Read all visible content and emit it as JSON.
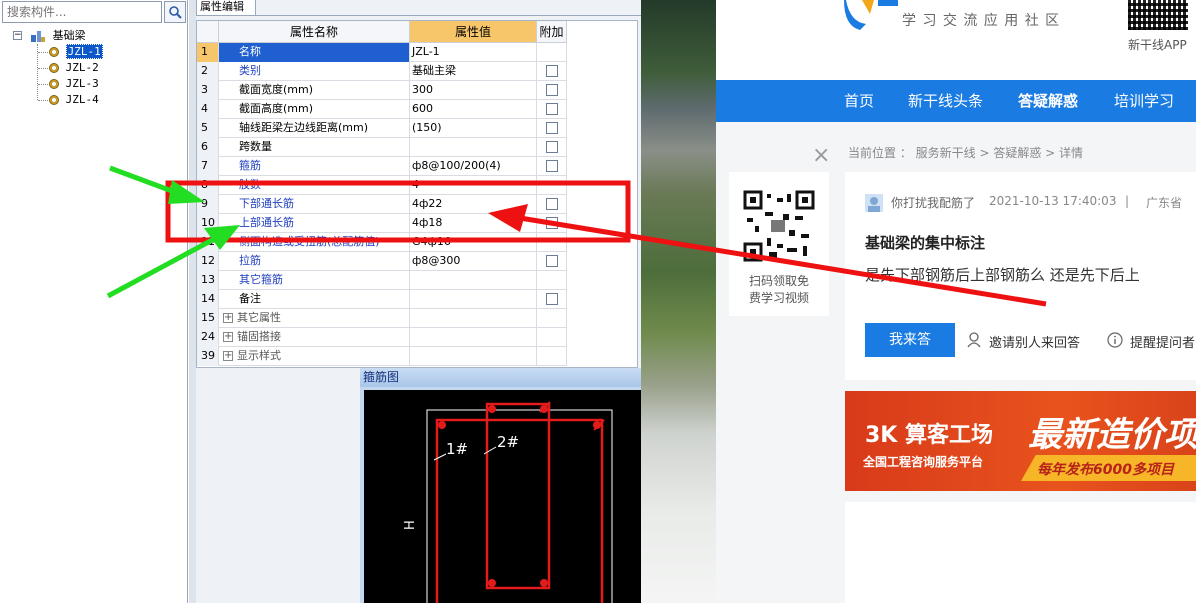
{
  "tree": {
    "search_placeholder": "搜索构件...",
    "root_label": "基础梁",
    "items": [
      "JZL-1",
      "JZL-2",
      "JZL-3",
      "JZL-4"
    ],
    "selected": "JZL-1"
  },
  "props": {
    "tab_label": "属性编辑",
    "headers": {
      "name": "属性名称",
      "value": "属性值",
      "add": "附加"
    },
    "rows": [
      {
        "num": "1",
        "name": "名称",
        "value": "JZL-1",
        "blue": true,
        "checkbox": false
      },
      {
        "num": "2",
        "name": "类别",
        "value": "基础主梁",
        "blue": true,
        "checkbox": true
      },
      {
        "num": "3",
        "name": "截面宽度(mm)",
        "value": "300",
        "blue": false,
        "checkbox": true
      },
      {
        "num": "4",
        "name": "截面高度(mm)",
        "value": "600",
        "blue": false,
        "checkbox": true
      },
      {
        "num": "5",
        "name": "轴线距梁左边线距离(mm)",
        "value": "(150)",
        "blue": false,
        "checkbox": true
      },
      {
        "num": "6",
        "name": "跨数量",
        "value": "",
        "blue": false,
        "checkbox": true
      },
      {
        "num": "7",
        "name": "箍筋",
        "value": "ф8@100/200(4)",
        "blue": true,
        "checkbox": true
      },
      {
        "num": "8",
        "name": "肢数",
        "value": "4",
        "blue": true,
        "checkbox": false
      },
      {
        "num": "9",
        "name": "下部通长筋",
        "value": "4ф22",
        "blue": true,
        "checkbox": true
      },
      {
        "num": "10",
        "name": "上部通长筋",
        "value": "4ф18",
        "blue": true,
        "checkbox": true
      },
      {
        "num": "11",
        "name": "侧面构造或受扭筋(总配筋值)",
        "value": "G4ф16",
        "blue": true,
        "checkbox": false
      },
      {
        "num": "12",
        "name": "拉筋",
        "value": "ф8@300",
        "blue": true,
        "checkbox": true
      },
      {
        "num": "13",
        "name": "其它箍筋",
        "value": "",
        "blue": true,
        "checkbox": false
      },
      {
        "num": "14",
        "name": "备注",
        "value": "",
        "blue": false,
        "checkbox": true
      },
      {
        "num": "15",
        "name": "其它属性",
        "value": "",
        "blue": false,
        "checkbox": false,
        "group": true
      },
      {
        "num": "24",
        "name": "锚固搭接",
        "value": "",
        "blue": false,
        "checkbox": false,
        "group": true
      },
      {
        "num": "39",
        "name": "显示样式",
        "value": "",
        "blue": false,
        "checkbox": false,
        "group": true
      }
    ]
  },
  "rebar": {
    "title": "箍筋图",
    "label1": "1#",
    "label2": "2#",
    "height_label": "H"
  },
  "site": {
    "slogan": "学 习 交 流 应 用 社 区",
    "app_label": "新干线APP",
    "nav": [
      "首页",
      "新干线头条",
      "答疑解惑",
      "培训学习"
    ],
    "breadcrumb": "当前位置 ： 服务新干线 > 答疑解惑 > 详情",
    "qr_caption_1": "扫码领取免",
    "qr_caption_2": "费学习视频",
    "close_glyph": "×",
    "post_user": "你打扰我配筋了",
    "post_time": "2021-10-13 17:40:03",
    "post_sep": "|",
    "post_region": "广东省",
    "post_title": "基础梁的集中标注",
    "post_body": "是先下部钢筋后上部钢筋么 还是先下后上",
    "answer_btn": "我来答",
    "invite_label": "邀请别人来回答",
    "remind_label": "提醒提问者",
    "banner_brand": "算客工场",
    "banner_sub": "全国工程咨询服务平台",
    "banner_headline": "最新造价项",
    "banner_tag": "每年发布6000多项目"
  },
  "colors": {
    "annotation_red": "#ee1111",
    "annotation_green": "#22dd22",
    "nav_blue": "#1a7be3",
    "banner_red": "#d93a1c"
  }
}
